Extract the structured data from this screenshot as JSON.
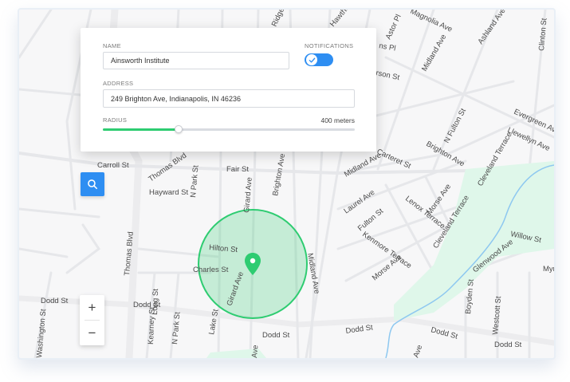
{
  "form": {
    "name_label": "NAME",
    "name_value": "Ainsworth Institute",
    "notifications_label": "NOTIFICATIONS",
    "notifications_on": true,
    "address_label": "ADDRESS",
    "address_value": "249 Brighton Ave, Indianapolis, IN 46236",
    "radius_label": "RADIUS",
    "radius_value": "400 meters",
    "radius_fraction": 0.3
  },
  "controls": {
    "search_icon": "search-icon",
    "zoom_in_label": "+",
    "zoom_out_label": "−"
  },
  "map": {
    "marker_icon": "map-pin-icon",
    "accent_color": "#2e8ef2",
    "radius_color": "#2ecc71",
    "park_color": "#dff7ea",
    "street_labels": {
      "ridge": "Ridge",
      "hawthorne": "Hawthorne",
      "magnolia": "Magnolia Ave",
      "ashland": "Ashland Ave",
      "clinton": "Clinton St",
      "astor": "Astor Pl",
      "ns_pl": "ns Pl",
      "midland_top": "Midland Ave",
      "rson": "rson St",
      "evergreen": "Evergreen Ave",
      "llewellyn": "Llewellyn Ave",
      "n_fulton": "N Fulton St",
      "brighton_right": "Brighton Ave",
      "cleveland_top": "Cleveland Terrace",
      "carroll": "Carroll St",
      "thomas_blvd_top": "Thomas Blvd",
      "n_park_top": "N Park St",
      "fair": "Fair St",
      "girard_top": "Girard Ave",
      "brighton_center": "Brighton Ave",
      "midland_mid": "Midland Ave",
      "carteret": "Carteret St",
      "hayward": "Hayward St",
      "laurel": "Laurel Ave",
      "morse_top": "Morse Ave",
      "lenox": "Lenox Terrace",
      "cleveland_mid": "Cleveland Terrace",
      "fulton": "Fulton St",
      "kenmore": "Kenmore Terrace",
      "glenwood": "Glenwood Ave",
      "willow": "Willow St",
      "myr": "Myr",
      "thomas_blvd_low": "Thomas Blvd",
      "hilton": "Hilton St",
      "charles": "Charles St",
      "girard_low": "Girard Ave",
      "midland_right": "Midland Ave",
      "morse_low": "Morse Ave",
      "dodd_left": "Dodd St",
      "dodd_mid": "Dodd St",
      "dodd_center": "Dodd St",
      "dodd_right1": "Dodd St",
      "dodd_right2": "Dodd St",
      "dodd_far": "Dodd St",
      "washington": "Washington St",
      "long": "Long St",
      "kearney": "Kearney St",
      "n_park_low": "N Park St",
      "lake": "Lake St",
      "boyden": "Boyden St",
      "westcott": "Westcott St",
      "ave_low": "Ave",
      "ave_low2": "Ave"
    }
  }
}
